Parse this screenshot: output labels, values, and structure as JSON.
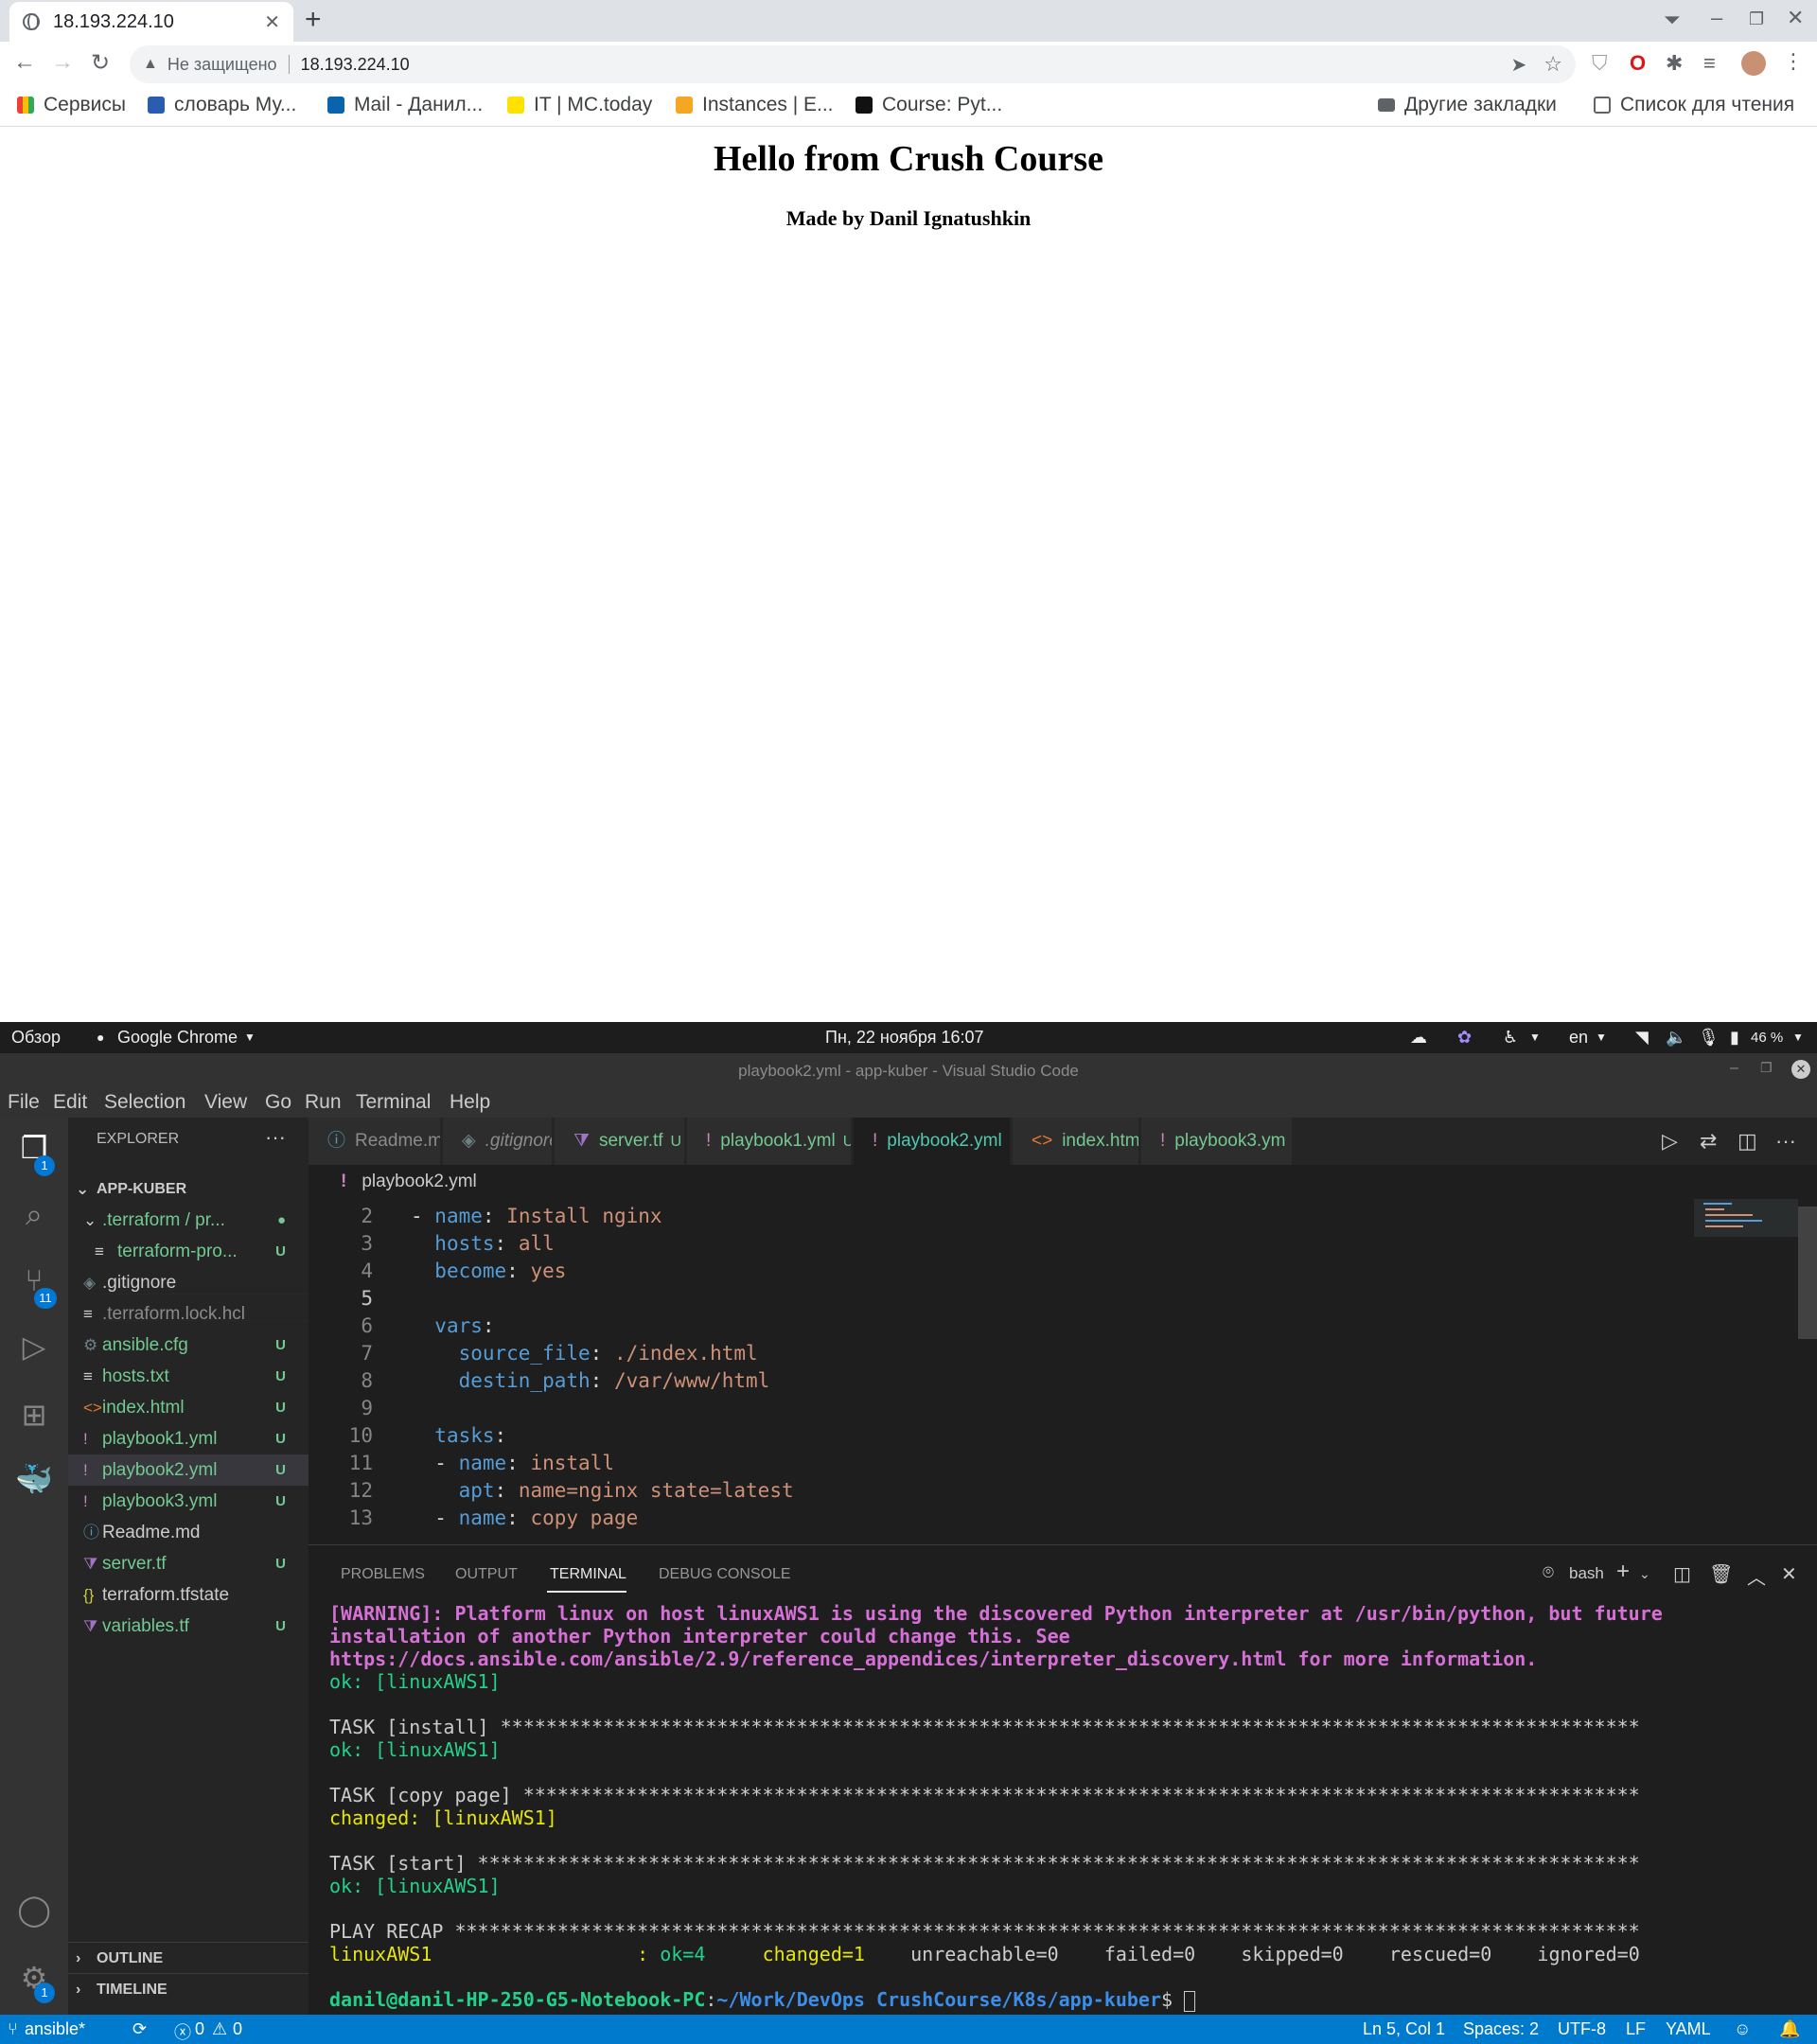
{
  "browser": {
    "tab_title": "18.193.224.10",
    "insecure_label": "Не защищено",
    "url": "18.193.224.10",
    "bookmarks": [
      "Сервисы",
      "словарь Му...",
      "Mail - Данил...",
      "IT | MC.today",
      "Instances | E...",
      "Course: Pyt..."
    ],
    "other_bookmarks": "Другие закладки",
    "reading_list": "Список для чтения"
  },
  "page": {
    "heading": "Hello from Crush Course",
    "subheading": "Made by Danil Ignatushkin"
  },
  "gnome": {
    "overview": "Обзор",
    "app": "Google Chrome",
    "clock": "Пн, 22 ноября  16:07",
    "lang": "en",
    "battery": "46 %"
  },
  "vscode": {
    "title": "playbook2.yml - app-kuber - Visual Studio Code",
    "menu": [
      "File",
      "Edit",
      "Selection",
      "View",
      "Go",
      "Run",
      "Terminal",
      "Help"
    ],
    "explorer_label": "EXPLORER",
    "project": "APP-KUBER",
    "badges": {
      "explorer": "1",
      "scm": "11",
      "settings": "1"
    },
    "files": [
      {
        "name": ".terraform / pr...",
        "status": "●",
        "color": "#73c991"
      },
      {
        "name": "terraform-pro...",
        "status": "U",
        "color": "#73c991"
      },
      {
        "name": ".gitignore",
        "status": "",
        "color": "#cccccc"
      },
      {
        "name": ".terraform.lock.hcl",
        "status": "",
        "color": "#8b8b8b"
      },
      {
        "name": "ansible.cfg",
        "status": "U",
        "color": "#73c991"
      },
      {
        "name": "hosts.txt",
        "status": "U",
        "color": "#73c991"
      },
      {
        "name": "index.html",
        "status": "U",
        "color": "#73c991"
      },
      {
        "name": "playbook1.yml",
        "status": "U",
        "color": "#73c991"
      },
      {
        "name": "playbook2.yml",
        "status": "U",
        "color": "#73c991"
      },
      {
        "name": "playbook3.yml",
        "status": "U",
        "color": "#73c991"
      },
      {
        "name": "Readme.md",
        "status": "",
        "color": "#cccccc"
      },
      {
        "name": "server.tf",
        "status": "U",
        "color": "#73c991"
      },
      {
        "name": "terraform.tfstate",
        "status": "",
        "color": "#cccccc"
      },
      {
        "name": "variables.tf",
        "status": "U",
        "color": "#73c991"
      }
    ],
    "outline": "OUTLINE",
    "timeline": "TIMELINE",
    "tabs": [
      {
        "label": "Readme.md",
        "status": ""
      },
      {
        "label": ".gitignore",
        "status": ""
      },
      {
        "label": "server.tf",
        "status": "U"
      },
      {
        "label": "playbook1.yml",
        "status": "U"
      },
      {
        "label": "playbook2.yml",
        "status": "U"
      },
      {
        "label": "index.html",
        "status": "U"
      },
      {
        "label": "playbook3.ym",
        "status": ""
      }
    ],
    "breadcrumb": "playbook2.yml",
    "code_lines": [
      {
        "n": "2",
        "t": "- name: Install nginx"
      },
      {
        "n": "3",
        "t": "  hosts: all"
      },
      {
        "n": "4",
        "t": "  become: yes"
      },
      {
        "n": "5",
        "t": ""
      },
      {
        "n": "6",
        "t": "  vars:"
      },
      {
        "n": "7",
        "t": "    source_file: ./index.html"
      },
      {
        "n": "8",
        "t": "    destin_path: /var/www/html"
      },
      {
        "n": "9",
        "t": ""
      },
      {
        "n": "10",
        "t": "  tasks:"
      },
      {
        "n": "11",
        "t": "  - name: install"
      },
      {
        "n": "12",
        "t": "    apt: name=nginx state=latest"
      },
      {
        "n": "13",
        "t": "  - name: copy page"
      }
    ],
    "panel_tabs": [
      "PROBLEMS",
      "OUTPUT",
      "TERMINAL",
      "DEBUG CONSOLE"
    ],
    "shell": "bash",
    "terminal": {
      "warning1": "[WARNING]: Platform linux on host linuxAWS1 is using the discovered Python interpreter at /usr/bin/python, but future",
      "warning2": "installation of another Python interpreter could change this. See",
      "warning3": "https://docs.ansible.com/ansible/2.9/reference_appendices/interpreter_discovery.html for more information.",
      "ok1": "ok: [linuxAWS1]",
      "task_install": "TASK [install] ****************************************************************************************************",
      "ok2": "ok: [linuxAWS1]",
      "task_copy": "TASK [copy page] **************************************************************************************************",
      "changed": "changed: [linuxAWS1]",
      "task_start": "TASK [start] ******************************************************************************************************",
      "ok3": "ok: [linuxAWS1]",
      "recap": "PLAY RECAP ********************************************************************************************************",
      "host": "linuxAWS1                  : ",
      "ok_count": "ok=4",
      "changed_count": "changed=1",
      "rest": "unreachable=0    failed=0    skipped=0    rescued=0    ignored=0",
      "prompt_user": "danil@danil-HP-250-G5-Notebook-PC",
      "prompt_path": "~/Work/DevOps CrushCourse/K8s/app-kuber",
      "prompt_end": "$ "
    },
    "status": {
      "branch": "ansible*",
      "problems": "0",
      "warnings": "0",
      "position": "Ln 5, Col 1",
      "spaces": "Spaces: 2",
      "encoding": "UTF-8",
      "eol": "LF",
      "language": "YAML"
    }
  }
}
